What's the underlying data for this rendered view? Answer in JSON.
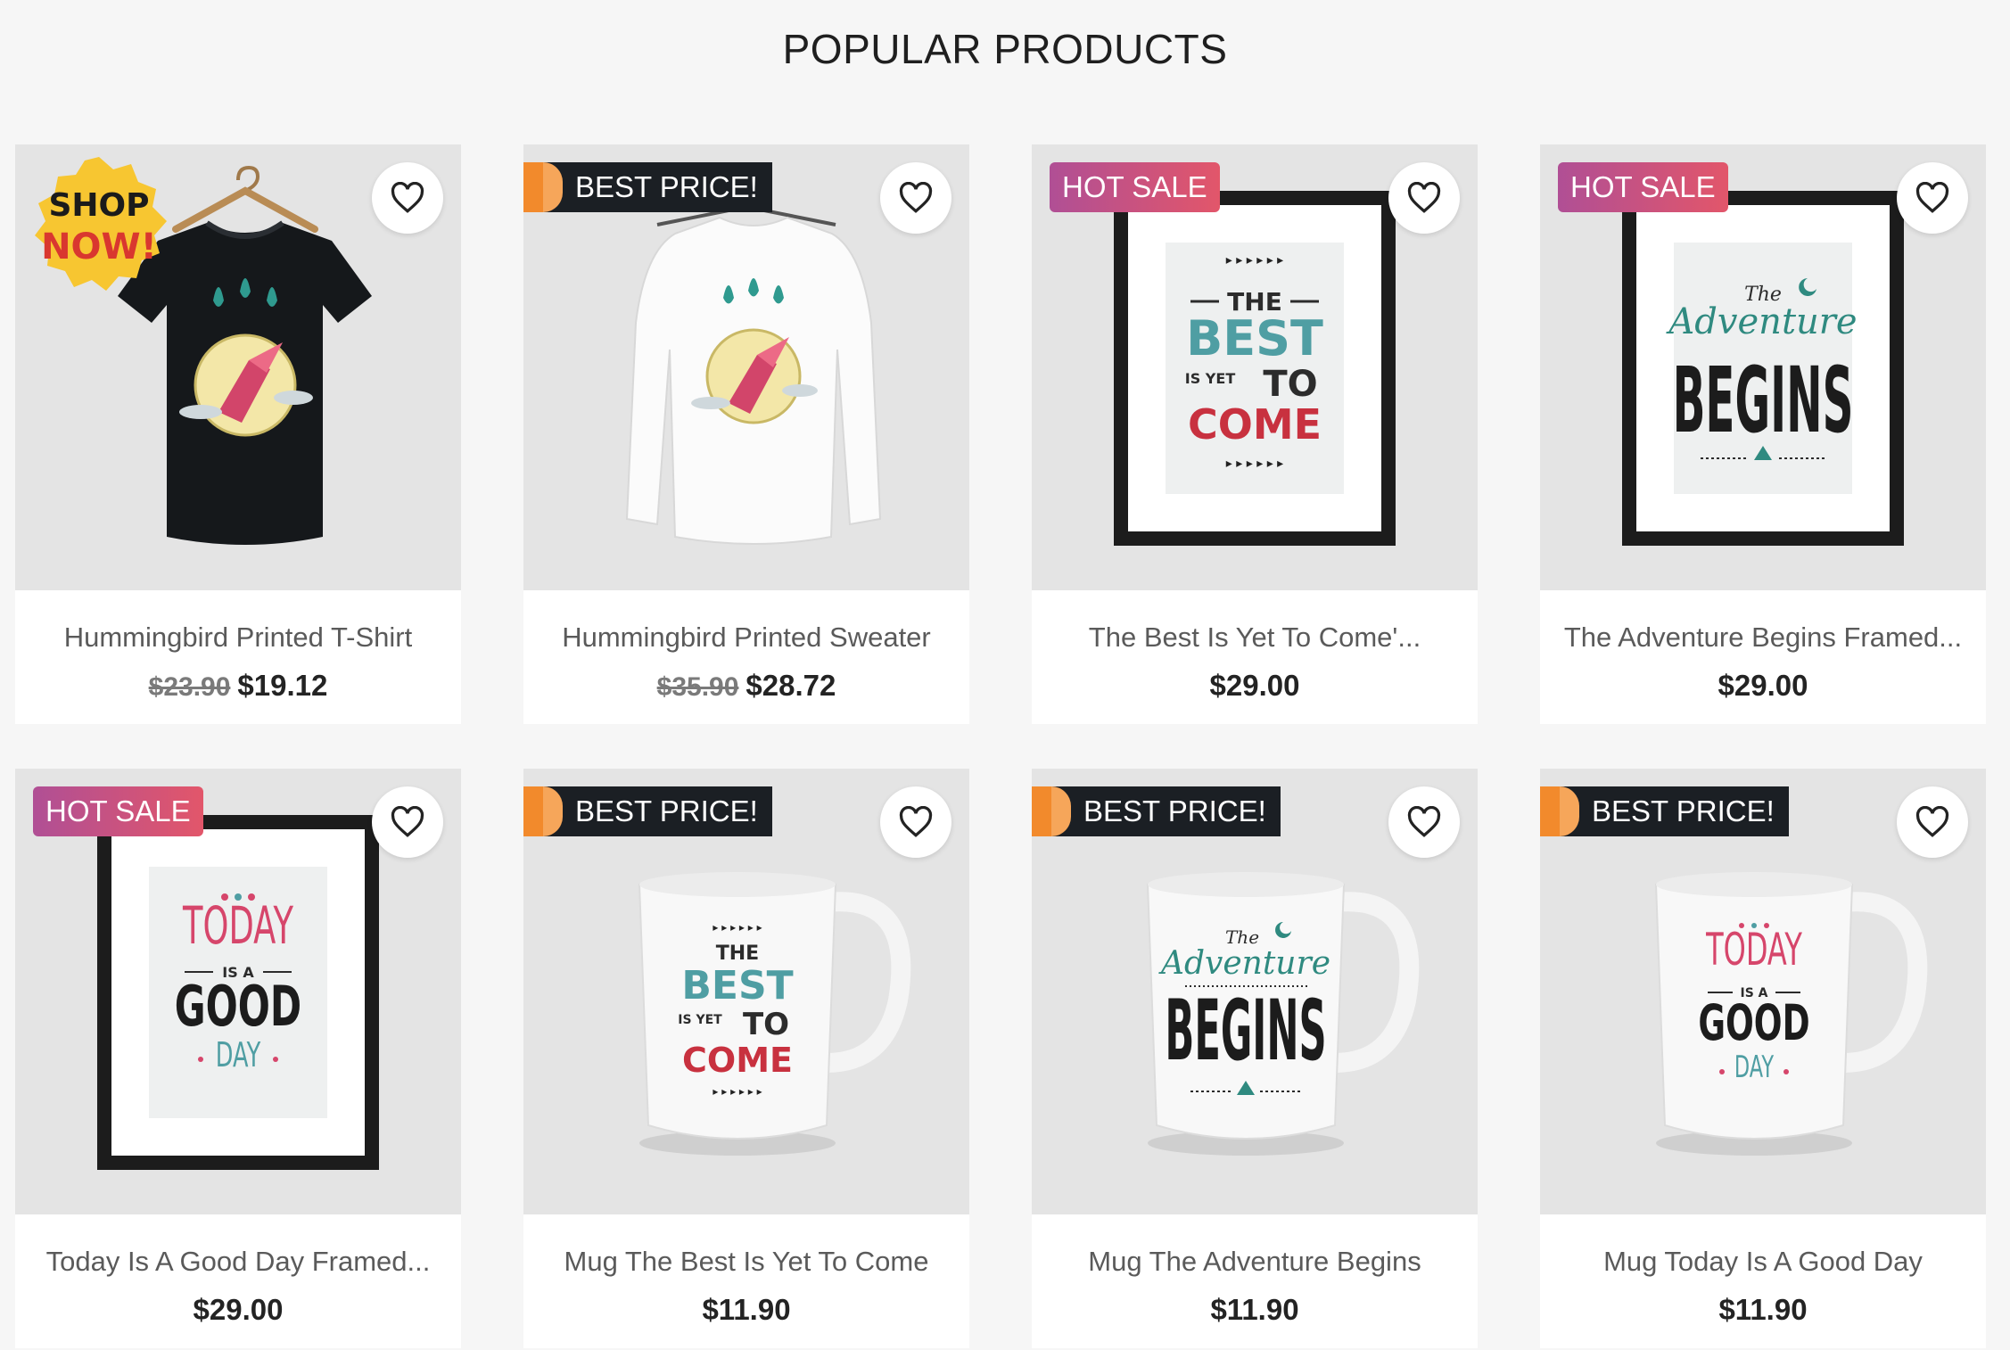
{
  "section": {
    "title": "POPULAR PRODUCTS"
  },
  "colors": {
    "hot_sale_start": "#b04f95",
    "hot_sale_end": "#e2566a",
    "best_price_bg": "#1b1f24",
    "best_price_accent": "#f28a2c",
    "shop_now_badge": "#f7c631"
  },
  "products": [
    {
      "name": "Hummingbird Printed T-Shirt",
      "regular_price": "$23.90",
      "price": "$19.12",
      "badge": "",
      "sticker": {
        "line1": "SHOP",
        "line2": "NOW!"
      },
      "image": "tshirt-black"
    },
    {
      "name": "Hummingbird Printed Sweater",
      "regular_price": "$35.90",
      "price": "$28.72",
      "badge": "BEST PRICE!",
      "image": "sweater-white"
    },
    {
      "name": "The Best Is Yet To Come'...",
      "regular_price": "",
      "price": "$29.00",
      "badge": "HOT SALE",
      "image": "frame-best"
    },
    {
      "name": "The Adventure Begins Framed...",
      "regular_price": "",
      "price": "$29.00",
      "badge": "HOT SALE",
      "image": "frame-adventure"
    },
    {
      "name": "Today Is A Good Day Framed...",
      "regular_price": "",
      "price": "$29.00",
      "badge": "HOT SALE",
      "image": "frame-today"
    },
    {
      "name": "Mug The Best Is Yet To Come",
      "regular_price": "",
      "price": "$11.90",
      "badge": "BEST PRICE!",
      "image": "mug-best"
    },
    {
      "name": "Mug The Adventure Begins",
      "regular_price": "",
      "price": "$11.90",
      "badge": "BEST PRICE!",
      "image": "mug-adventure"
    },
    {
      "name": "Mug Today Is A Good Day",
      "regular_price": "",
      "price": "$11.90",
      "badge": "BEST PRICE!",
      "image": "mug-today"
    }
  ],
  "artwork": {
    "best": {
      "the": "THE",
      "best": "BEST",
      "is_yet": "IS YET",
      "to": "TO",
      "come": "COME"
    },
    "adventure": {
      "the": "The",
      "adventure": "Adventure",
      "begins": "BEGINS"
    },
    "today": {
      "today": "TODAY",
      "is_a": "IS A",
      "good": "GOOD",
      "day": "DAY"
    }
  },
  "icons": {
    "wishlist": "heart-outline-icon"
  }
}
